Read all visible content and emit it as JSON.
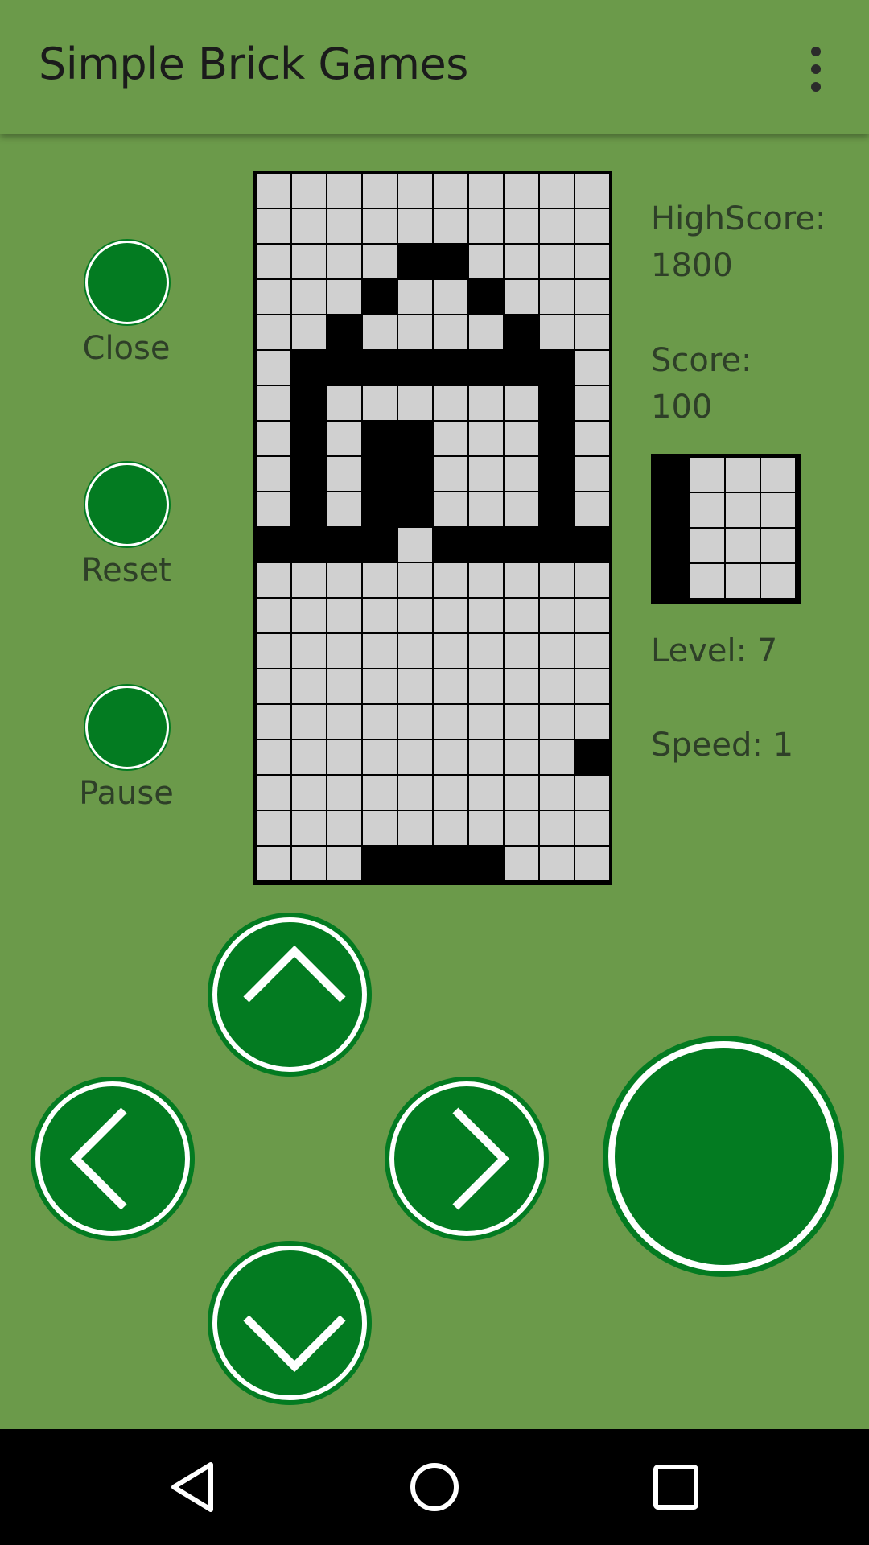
{
  "app": {
    "title": "Simple Brick Games"
  },
  "toolbar": {
    "overflow_icon": "more-vert-icon"
  },
  "side_buttons": [
    {
      "label": "Close"
    },
    {
      "label": "Reset"
    },
    {
      "label": "Pause"
    }
  ],
  "stats": {
    "highscore_label": "HighScore:",
    "highscore_value": "1800",
    "score_label": "Score:",
    "score_value": "100",
    "level_text": "Level: 7",
    "speed_text": "Speed: 1"
  },
  "board": {
    "cols": 10,
    "rows": 20,
    "filled": [
      [
        2,
        4
      ],
      [
        2,
        5
      ],
      [
        3,
        3
      ],
      [
        3,
        6
      ],
      [
        4,
        2
      ],
      [
        4,
        7
      ],
      [
        5,
        1
      ],
      [
        5,
        2
      ],
      [
        5,
        3
      ],
      [
        5,
        4
      ],
      [
        5,
        5
      ],
      [
        5,
        6
      ],
      [
        5,
        7
      ],
      [
        5,
        8
      ],
      [
        6,
        1
      ],
      [
        6,
        8
      ],
      [
        7,
        1
      ],
      [
        7,
        3
      ],
      [
        7,
        4
      ],
      [
        7,
        8
      ],
      [
        8,
        1
      ],
      [
        8,
        3
      ],
      [
        8,
        4
      ],
      [
        8,
        8
      ],
      [
        9,
        1
      ],
      [
        9,
        3
      ],
      [
        9,
        4
      ],
      [
        9,
        8
      ],
      [
        10,
        0
      ],
      [
        10,
        1
      ],
      [
        10,
        2
      ],
      [
        10,
        3
      ],
      [
        10,
        5
      ],
      [
        10,
        6
      ],
      [
        10,
        7
      ],
      [
        10,
        8
      ],
      [
        10,
        9
      ],
      [
        16,
        9
      ],
      [
        19,
        3
      ],
      [
        19,
        4
      ],
      [
        19,
        5
      ],
      [
        19,
        6
      ]
    ]
  },
  "next_piece": {
    "cols": 4,
    "rows": 4,
    "filled": [
      [
        0,
        0
      ],
      [
        1,
        0
      ],
      [
        2,
        0
      ],
      [
        3,
        0
      ]
    ]
  },
  "colors": {
    "background": "#6b9a4a",
    "button_green": "#037b21",
    "cell_empty": "#d0d0d0",
    "cell_filled": "#000000",
    "text": "#2e3f28"
  },
  "controls": {
    "up_icon": "chevron-up-icon",
    "left_icon": "chevron-left-icon",
    "right_icon": "chevron-right-icon",
    "down_icon": "chevron-down-icon",
    "action_icon": "rotate-action-button"
  },
  "navbar": {
    "back_icon": "back-triangle-icon",
    "home_icon": "home-circle-icon",
    "recents_icon": "recents-square-icon"
  }
}
